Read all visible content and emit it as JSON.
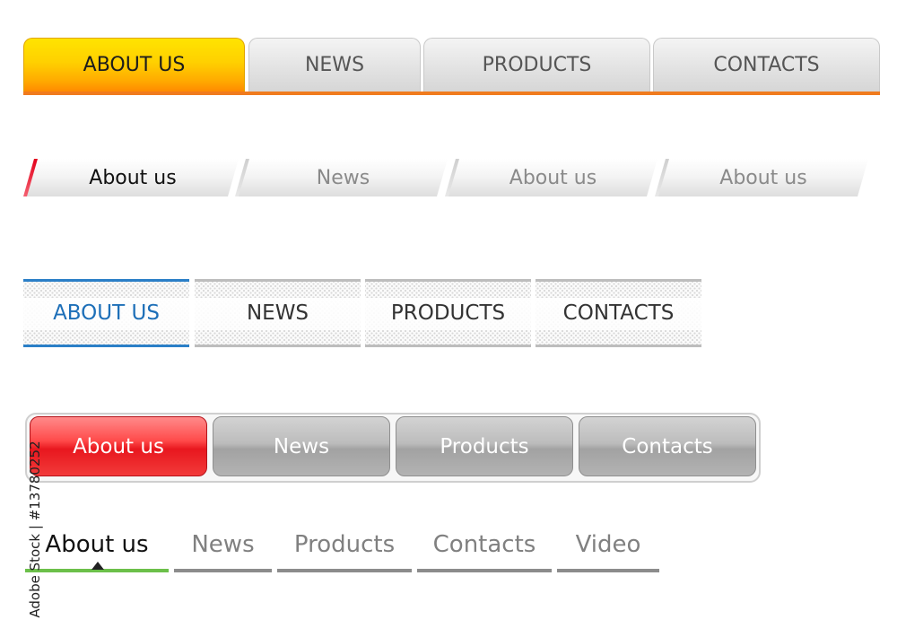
{
  "watermark": "Adobe Stock | #13780252",
  "nav1": {
    "accent": "#f07b1e",
    "tabs": [
      {
        "label": "ABOUT US",
        "active": true
      },
      {
        "label": "NEWS",
        "active": false
      },
      {
        "label": "PRODUCTS",
        "active": false
      },
      {
        "label": "CONTACTS",
        "active": false
      }
    ]
  },
  "nav2": {
    "accent": "#e3001b",
    "tabs": [
      {
        "label": "About us",
        "active": true
      },
      {
        "label": "News",
        "active": false
      },
      {
        "label": "About us",
        "active": false
      },
      {
        "label": "About us",
        "active": false
      }
    ]
  },
  "nav3": {
    "accent": "#2b7fc7",
    "tabs": [
      {
        "label": "ABOUT US",
        "active": true
      },
      {
        "label": "NEWS",
        "active": false
      },
      {
        "label": "PRODUCTS",
        "active": false
      },
      {
        "label": "CONTACTS",
        "active": false
      }
    ]
  },
  "nav4": {
    "accent": "#e8171e",
    "tabs": [
      {
        "label": "About us",
        "active": true
      },
      {
        "label": "News",
        "active": false
      },
      {
        "label": "Products",
        "active": false
      },
      {
        "label": "Contacts",
        "active": false
      }
    ]
  },
  "nav5": {
    "accent": "#6cc04a",
    "tabs": [
      {
        "label": "About us",
        "active": true
      },
      {
        "label": "News",
        "active": false
      },
      {
        "label": "Products",
        "active": false
      },
      {
        "label": "Contacts",
        "active": false
      },
      {
        "label": "Video",
        "active": false
      }
    ]
  }
}
